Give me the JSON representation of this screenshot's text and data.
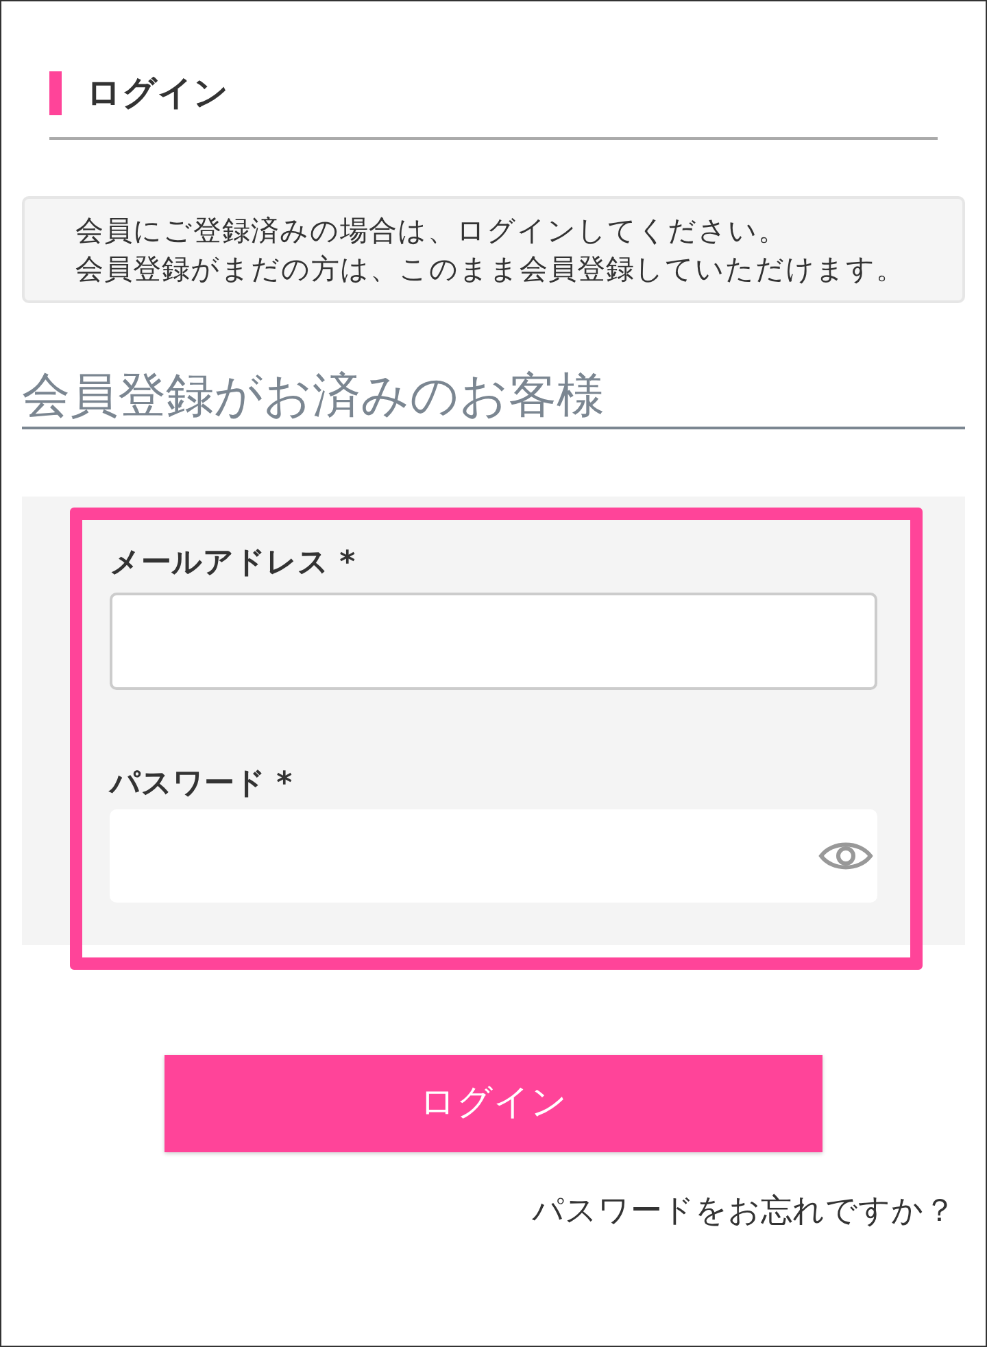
{
  "page_title": "ログイン",
  "notice": [
    "会員にご登録済みの場合は、ログインしてください。",
    "会員登録がまだの方は、このまま会員登録していただけます。"
  ],
  "section_heading": "会員登録がお済みのお客様",
  "form": {
    "highlighted": true,
    "fields": [
      {
        "kind": "email",
        "label": "メールアドレス *"
      },
      {
        "kind": "password",
        "label": "パスワード *"
      }
    ]
  },
  "submit_button": "ログイン",
  "forgot_link": "パスワードをお忘れですか？"
}
